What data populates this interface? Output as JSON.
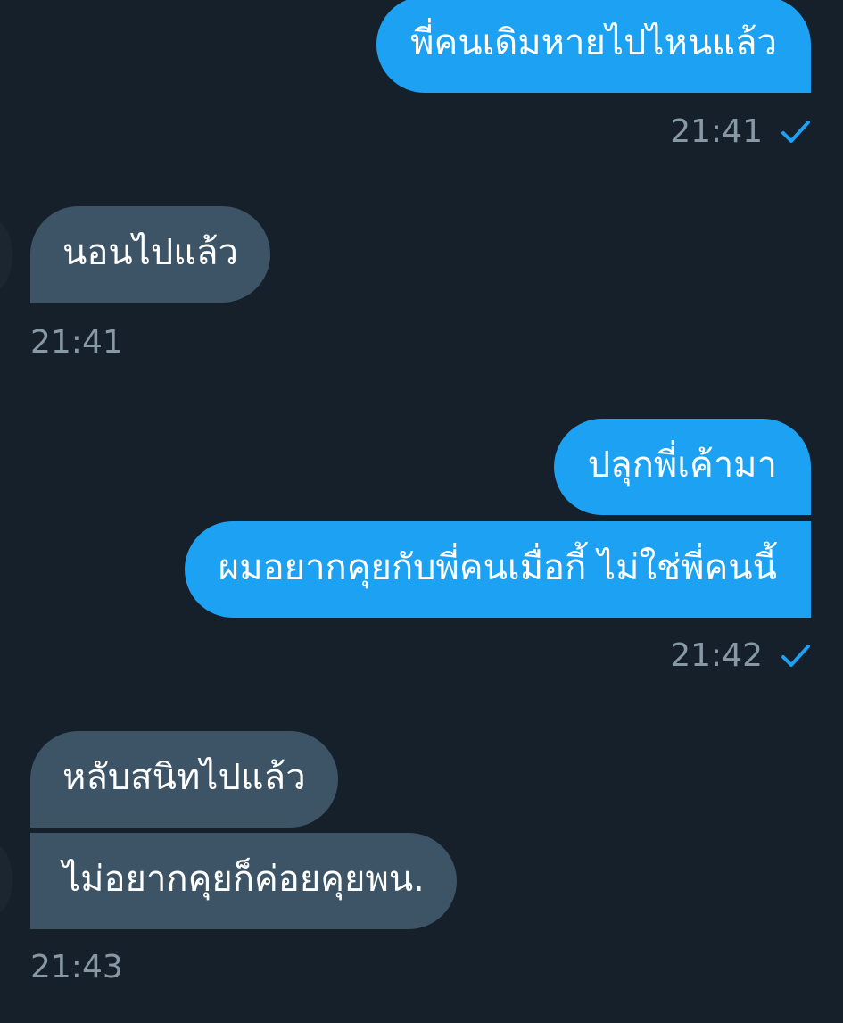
{
  "colors": {
    "background": "#15202b",
    "sent_bubble": "#1da1f2",
    "received_bubble": "#3d5466",
    "timestamp": "#8899a6",
    "check": "#1da1f2"
  },
  "messages": [
    {
      "text": "พี่คนเดิมหายไปไหนแล้ว"
    },
    {
      "text": "นอนไปแล้ว"
    },
    {
      "text": "ปลุกพี่เค้ามา"
    },
    {
      "text": "ผมอยากคุยกับพี่คนเมื่อกี้ ไม่ใช่พี่คนนี้"
    },
    {
      "text": "หลับสนิทไปแล้ว"
    },
    {
      "text": "ไม่อยากคุยก็ค่อยคุยพน."
    }
  ],
  "timestamps": [
    {
      "time": "21:41",
      "icon": "check-icon"
    },
    {
      "time": "21:41"
    },
    {
      "time": "21:42",
      "icon": "check-icon"
    },
    {
      "time": "21:43"
    }
  ]
}
